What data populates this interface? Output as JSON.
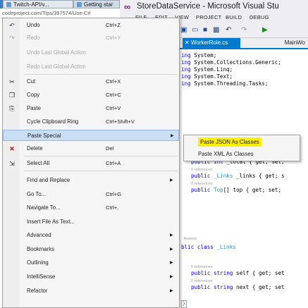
{
  "browser": {
    "tabs": [
      {
        "label": "Twitch-API/v..."
      },
      {
        "label": "Getting star"
      }
    ],
    "address": "codeproject.com/Tips/397574/Use-C#"
  },
  "vs": {
    "title": "StoreDataService - Microsoft Visual Stu",
    "menu": [
      "FILE",
      "EDIT",
      "VIEW",
      "PROJECT",
      "BUILD",
      "DEBUG"
    ],
    "doc_tabs": {
      "active": "WorkerRole.cs",
      "inactive": "MainWo"
    }
  },
  "code": {
    "usings": [
      {
        "kw": "ing",
        "text": "System;"
      },
      {
        "kw": "ing",
        "text": "System.Collections.Generic;"
      },
      {
        "kw": "ing",
        "text": "System.Linq;"
      },
      {
        "kw": "ing",
        "text": "System.Text;"
      },
      {
        "kw": "ing",
        "text": "System.Threading.Tasks;"
      }
    ],
    "ref0": "0 references",
    "ref_trunc": "0 references",
    "ref_short": "ference",
    "line_total_a": "public",
    "line_total_b": "int",
    "line_total_c": "_total { get; set;",
    "line_links_a": "public",
    "line_links_b": "_Links",
    "line_links_c": "_links { get; s",
    "line_top_a": "public",
    "line_top_b": "Top",
    "line_top_c": "[] top { get; set;",
    "line_class_a": "blic class",
    "line_class_b": "_Links",
    "line_self_a": "public",
    "line_self_b": "string",
    "line_self_c": "self { get; set",
    "line_next_a": "public",
    "line_next_b": "string",
    "line_next_c": "next { get; set",
    "brace": "}"
  },
  "menu": {
    "undo": {
      "label": "Undo",
      "shortcut": "Ctrl+Z"
    },
    "redo": {
      "label": "Redo",
      "shortcut": "Ctrl+Y"
    },
    "undo_global": {
      "label": "Undo Last Global Action"
    },
    "redo_global": {
      "label": "Redo Last Global Action"
    },
    "cut": {
      "label": "Cut",
      "shortcut": "Ctrl+X"
    },
    "copy": {
      "label": "Copy",
      "shortcut": "Ctrl+C"
    },
    "paste": {
      "label": "Paste",
      "shortcut": "Ctrl+V"
    },
    "cycle": {
      "label": "Cycle Clipboard Ring",
      "shortcut": "Ctrl+Shift+V"
    },
    "paste_special": {
      "label": "Paste Special"
    },
    "delete": {
      "label": "Delete",
      "shortcut": "Del"
    },
    "select_all": {
      "label": "Select All",
      "shortcut": "Ctrl+A"
    },
    "find_replace": {
      "label": "Find and Replace"
    },
    "goto": {
      "label": "Go To...",
      "shortcut": "Ctrl+G"
    },
    "navigate": {
      "label": "Navigate To...",
      "shortcut": "Ctrl+,"
    },
    "insert_file": {
      "label": "Insert File As Text..."
    },
    "advanced": {
      "label": "Advanced"
    },
    "bookmarks": {
      "label": "Bookmarks"
    },
    "outlining": {
      "label": "Outlining"
    },
    "intellisense": {
      "label": "IntelliSense"
    },
    "refactor": {
      "label": "Refactor"
    }
  },
  "submenu": {
    "paste_json": "Paste JSON As Classes",
    "paste_xml": "Paste XML As Classes"
  }
}
